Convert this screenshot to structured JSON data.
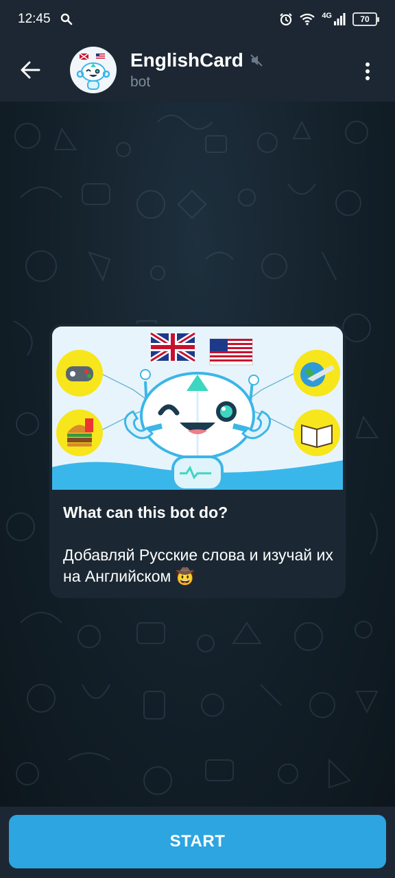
{
  "status_bar": {
    "time": "12:45",
    "network": "4G",
    "battery": "70"
  },
  "header": {
    "title": "EnglishCard",
    "subtitle": "bot",
    "back_icon": "arrow-left-icon",
    "muted_icon": "muted-speaker-icon",
    "menu_icon": "more-vertical-icon"
  },
  "card": {
    "heading": "What can this bot do?",
    "description": "Добавляй Русские слова и изучай их на Английском 🤠"
  },
  "bottom": {
    "start_label": "START"
  },
  "colors": {
    "header_bg": "#1c2733",
    "accent": "#2ca5e0",
    "card_bg": "#1b2834"
  }
}
